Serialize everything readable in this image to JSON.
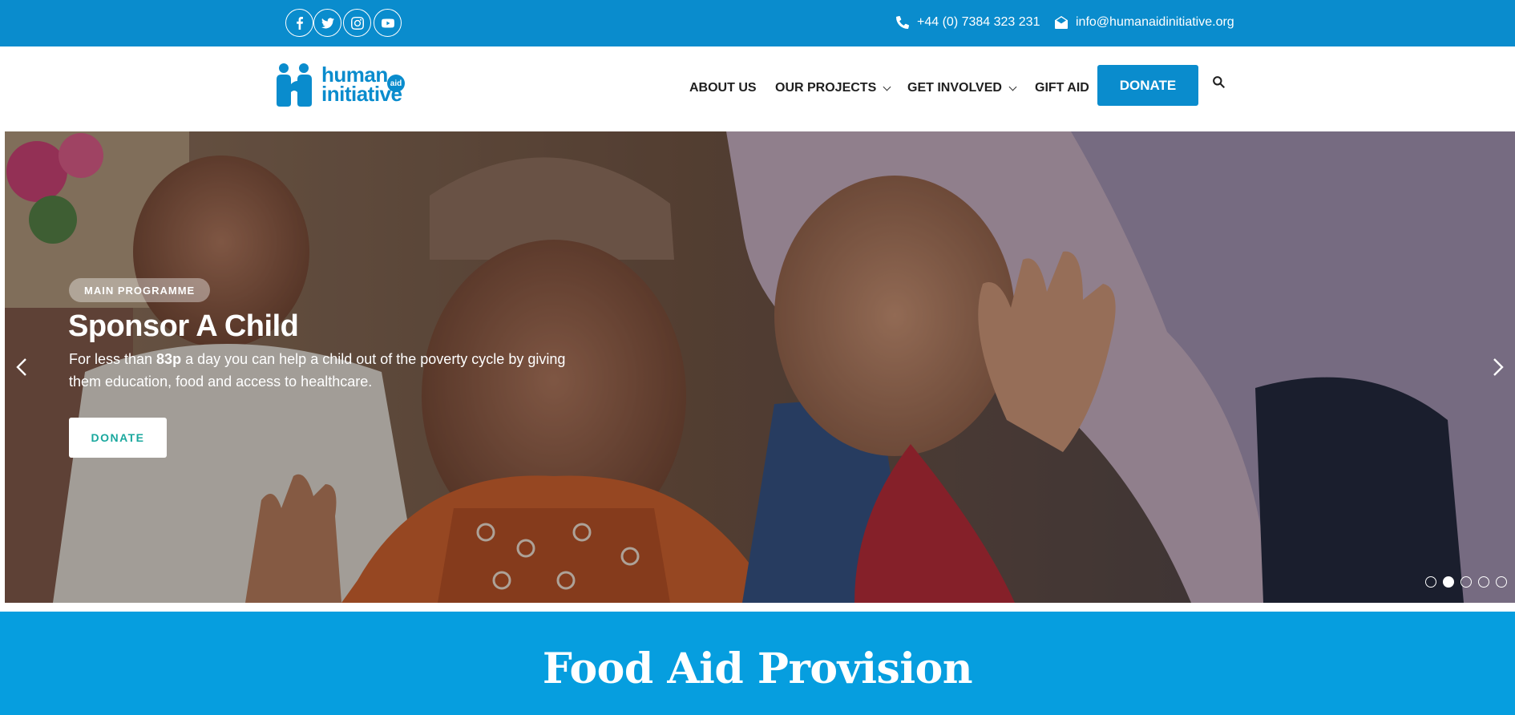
{
  "topbar": {
    "social": [
      {
        "name": "facebook-icon"
      },
      {
        "name": "twitter-icon"
      },
      {
        "name": "instagram-icon"
      },
      {
        "name": "youtube-icon"
      }
    ],
    "phone": "+44 (0) 7384 323 231",
    "email": "info@humanaidinitiative.org",
    "color": "#0a8ccd"
  },
  "header": {
    "logo": {
      "line1": "human",
      "line2": "initiative",
      "badge": "aid"
    },
    "nav": [
      {
        "label": "ABOUT US"
      },
      {
        "label": "OUR PROJECTS"
      },
      {
        "label": "GET INVOLVED"
      },
      {
        "label": "GIFT AID"
      }
    ],
    "donate_label": "DONATE",
    "search_icon": "search-icon"
  },
  "hero": {
    "badge": "MAIN PROGRAMME",
    "title": "Sponsor A Child",
    "desc_before": "For less than ",
    "desc_bold": "83p",
    "desc_after": " a day you can help a child out of the poverty cycle by giving them education, food and access to healthcare.",
    "button": "DONATE",
    "slides": 5,
    "active_slide": 2
  },
  "section": {
    "title": "Food Aid Provision",
    "color": "#069edf"
  }
}
